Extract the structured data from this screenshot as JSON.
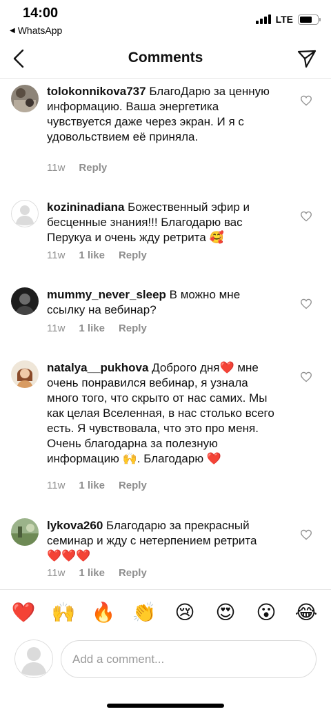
{
  "status": {
    "time": "14:00",
    "back_app": "WhatsApp",
    "network": "LTE",
    "battery_level": 0.7
  },
  "header": {
    "title": "Comments",
    "back_icon": "chevron-left-icon",
    "send_icon": "send-icon"
  },
  "comments": [
    {
      "username": "tolokonnikova737",
      "text": "БлагоДарю за ценную информацию. Ваша энергетика чувствуется даже через экран. И я с удовольствием её приняла.",
      "time": "11w",
      "likes": "",
      "reply": "Reply"
    },
    {
      "username": "kozininadiana",
      "text": "Божественный эфир и бесценные знания!!! Благодарю вас Перукуа и очень жду ретрита 🥰",
      "time": "11w",
      "likes": "1 like",
      "reply": "Reply"
    },
    {
      "username": "mummy_never_sleep",
      "text": "В можно мне ссылку на вебинар?",
      "time": "11w",
      "likes": "1 like",
      "reply": "Reply"
    },
    {
      "username": "natalya__pukhova",
      "text": "Доброго дня❤️ мне очень понравился вебинар, я узнала много того, что скрыто от нас самих. Мы как целая Вселенная, в нас столько всего есть. Я чувствовала, что это про меня. Очень благодарна за полезную информацию 🙌. Благодарю ❤️",
      "time": "11w",
      "likes": "1 like",
      "reply": "Reply"
    },
    {
      "username": "lykova260",
      "text": "Благодарю за прекрасный семинар и жду с нетерпением ретрита ❤️❤️❤️",
      "time": "11w",
      "likes": "1 like",
      "reply": "Reply"
    }
  ],
  "emoji_bar": [
    "❤️",
    "🙌",
    "🔥",
    "👏",
    "😢",
    "😍",
    "😮",
    "😂"
  ],
  "input": {
    "placeholder": "Add a comment..."
  },
  "colors": {
    "muted": "#8e8e8e",
    "divider": "#e6e6e6",
    "heart_red": "#e0202e"
  }
}
